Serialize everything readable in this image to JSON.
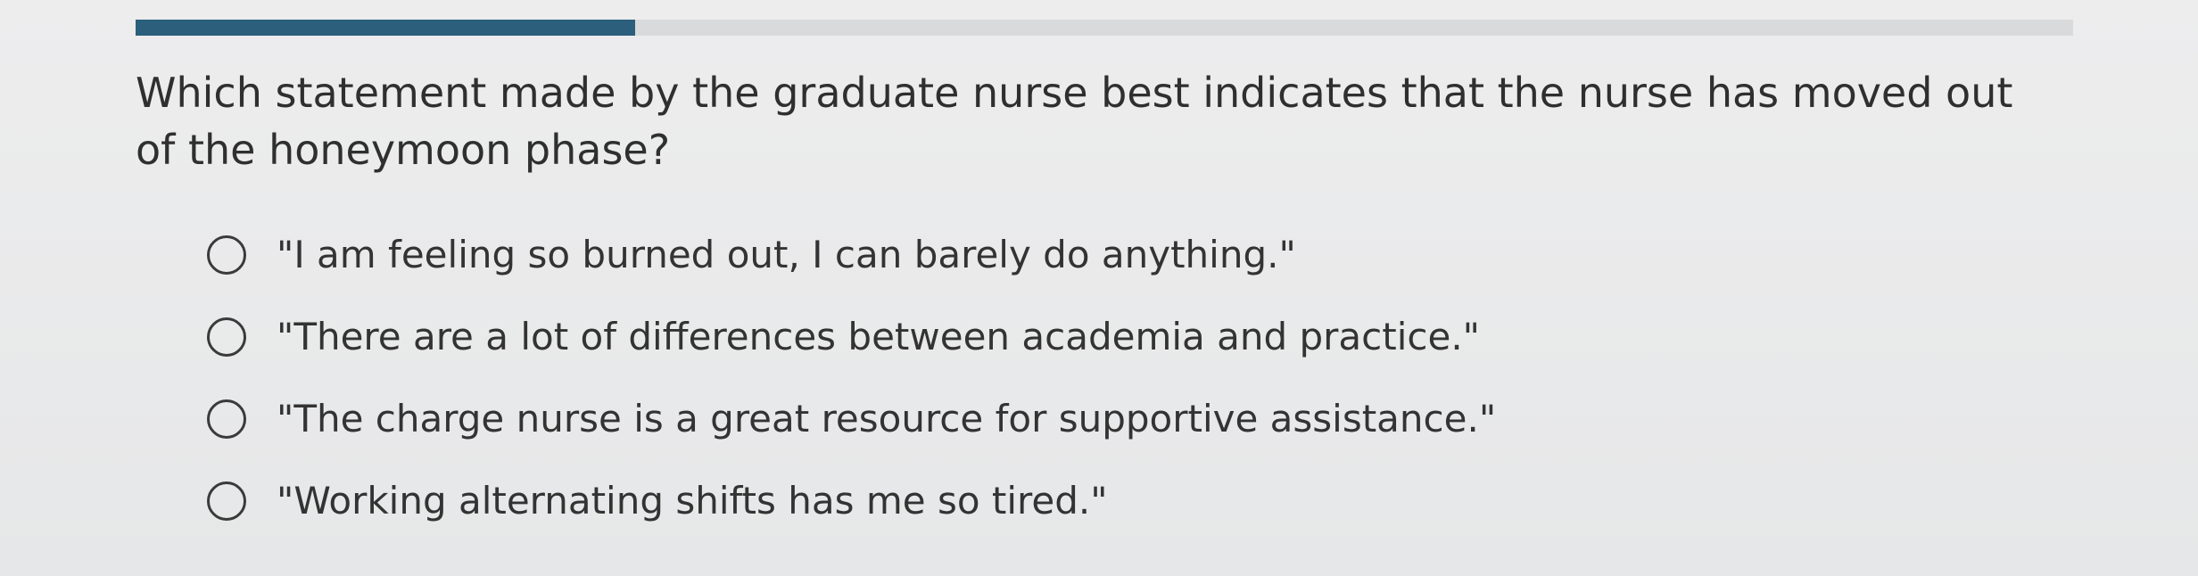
{
  "progress": {
    "fraction": 0.258,
    "fill_color": "#2c5f7c",
    "track_color": "#d9dadc"
  },
  "question": {
    "text": "Which statement made by the graduate nurse best indicates that the nurse has moved out of the honeymoon phase?"
  },
  "options": [
    {
      "label": "\"I am feeling so burned out, I can barely do anything.\"",
      "selected": false
    },
    {
      "label": "\"There are a lot of differences between academia and practice.\"",
      "selected": false
    },
    {
      "label": "\"The charge nurse is a great resource for supportive assistance.\"",
      "selected": false
    },
    {
      "label": "\"Working alternating shifts has me so tired.\"",
      "selected": false
    }
  ]
}
